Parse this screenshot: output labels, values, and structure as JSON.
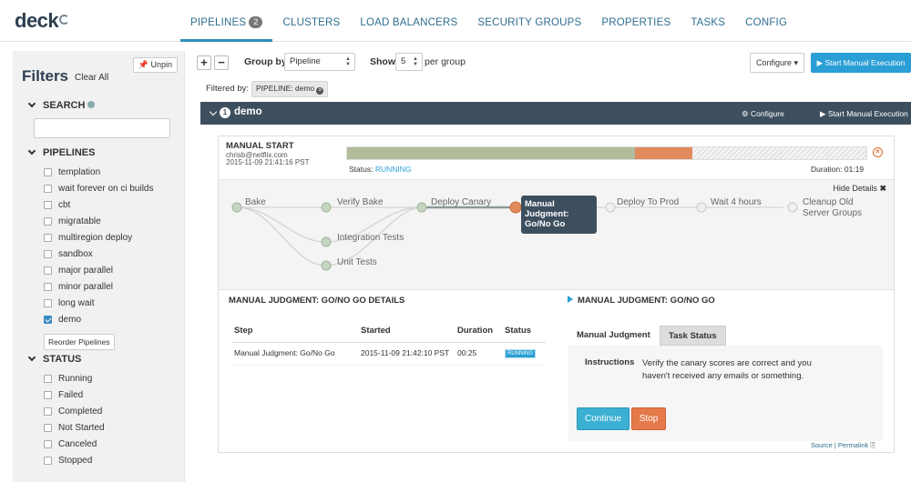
{
  "app": {
    "logo": "deck"
  },
  "nav": {
    "items": [
      {
        "label": "PIPELINES",
        "badge": "2",
        "active": true
      },
      {
        "label": "CLUSTERS"
      },
      {
        "label": "LOAD BALANCERS"
      },
      {
        "label": "SECURITY GROUPS"
      },
      {
        "label": "PROPERTIES"
      },
      {
        "label": "TASKS"
      },
      {
        "label": "CONFIG"
      }
    ]
  },
  "sidebar": {
    "title": "Filters",
    "clear_all": "Clear All",
    "unpin": "Unpin",
    "search": {
      "heading": "SEARCH",
      "value": ""
    },
    "pipelines": {
      "heading": "PIPELINES",
      "items": [
        {
          "label": "templation",
          "checked": false
        },
        {
          "label": "wait forever on ci builds",
          "checked": false
        },
        {
          "label": "cbt",
          "checked": false
        },
        {
          "label": "migratable",
          "checked": false
        },
        {
          "label": "multiregion deploy",
          "checked": false
        },
        {
          "label": "sandbox",
          "checked": false
        },
        {
          "label": "major parallel",
          "checked": false
        },
        {
          "label": "minor parallel",
          "checked": false
        },
        {
          "label": "long wait",
          "checked": false
        },
        {
          "label": "demo",
          "checked": true
        }
      ],
      "reorder": "Reorder Pipelines"
    },
    "status": {
      "heading": "STATUS",
      "items": [
        {
          "label": "Running",
          "checked": false
        },
        {
          "label": "Failed",
          "checked": false
        },
        {
          "label": "Completed",
          "checked": false
        },
        {
          "label": "Not Started",
          "checked": false
        },
        {
          "label": "Canceled",
          "checked": false
        },
        {
          "label": "Stopped",
          "checked": false
        }
      ]
    }
  },
  "toolbar": {
    "expand": "+",
    "collapse": "−",
    "group_by_label": "Group by",
    "group_by_value": "Pipeline",
    "show_label": "Show",
    "show_value": "5",
    "per_group": "per group",
    "configure": "Configure",
    "start_manual": "Start Manual Execution",
    "filtered_by": "Filtered by:",
    "filter_tag": "PIPELINE: demo"
  },
  "group": {
    "count": "1",
    "name": "demo",
    "configure": "Configure",
    "start_manual": "Start Manual Execution"
  },
  "execution": {
    "trigger": "MANUAL START",
    "user": "chrisb@netflix.com",
    "timestamp": "2015-11-09 21:41:16 PST",
    "status_label": "Status:",
    "status_value": "RUNNING",
    "duration_label": "Duration:",
    "duration_value": "01:19",
    "progress": {
      "completed": 0.555,
      "running": 0.11
    },
    "colors": {
      "completed": "#b2bb9b",
      "running": "#e08a5d",
      "accent": "#2a9fd6"
    },
    "hide_details": "Hide Details",
    "stages": {
      "bake": "Bake",
      "verify_bake": "Verify Bake",
      "deploy_canary": "Deploy Canary",
      "manual_judgment": "Manual Judgment: Go/No Go",
      "deploy_prod": "Deploy To Prod",
      "wait": "Wait 4 hours",
      "cleanup": "Cleanup Old Server Groups",
      "integration_tests": "Integration Tests",
      "unit_tests": "Unit Tests"
    }
  },
  "details": {
    "title": "MANUAL JUDGMENT: GO/NO GO DETAILS",
    "columns": [
      "Step",
      "Started",
      "Duration",
      "Status"
    ],
    "row": {
      "step": "Manual Judgment: Go/No Go",
      "started": "2015-11-09 21:42:10 PST",
      "duration": "00:25",
      "status": "RUNNING"
    },
    "right_title": "MANUAL JUDGMENT: GO/NO GO",
    "tabs": [
      "Manual Judgment",
      "Task Status"
    ],
    "instructions_label": "Instructions",
    "instructions_text": "Verify the canary scores are correct and you haven't received any emails or something.",
    "continue": "Continue",
    "stop": "Stop",
    "source": "Source",
    "permalink": "Permalink"
  }
}
